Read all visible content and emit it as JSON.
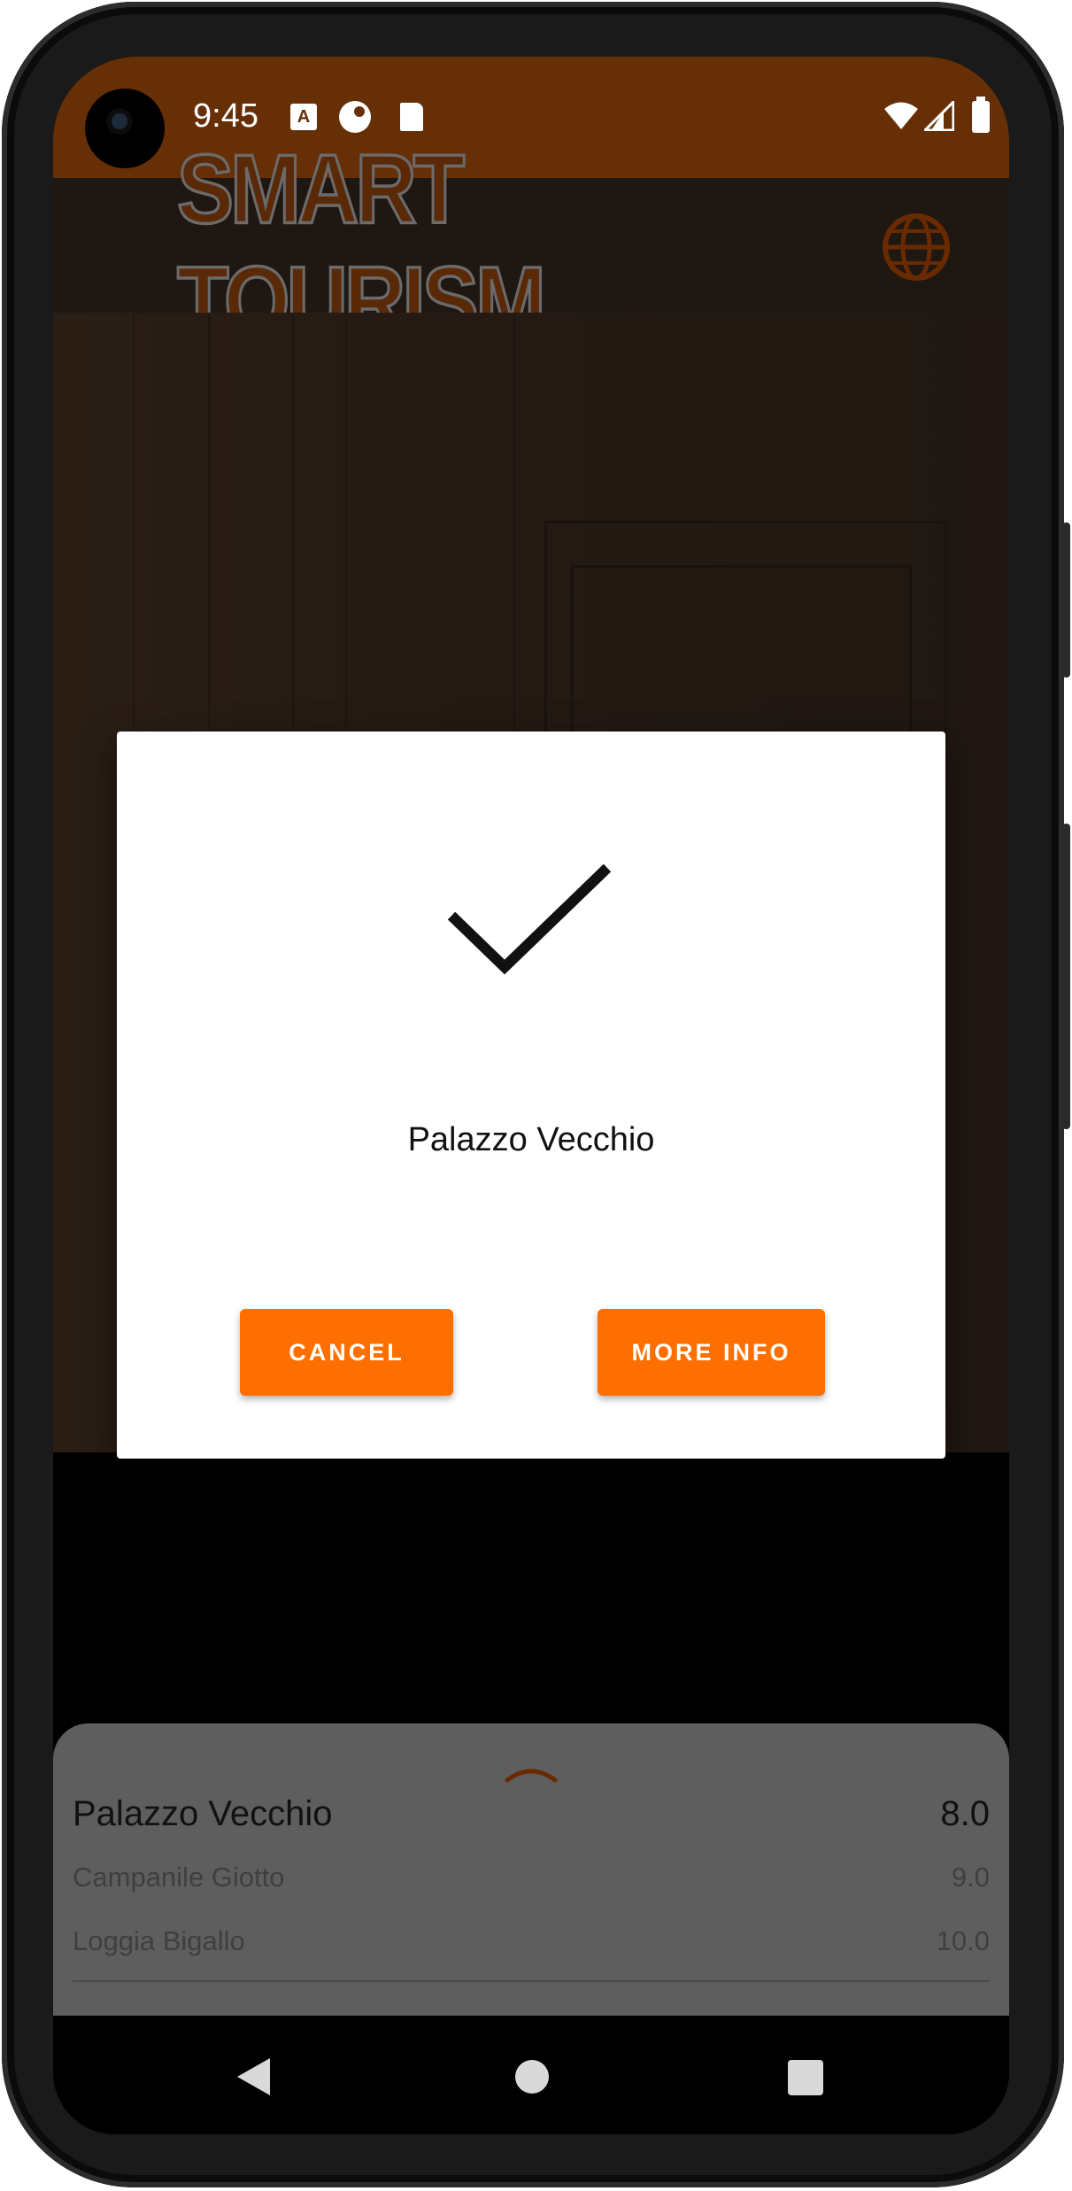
{
  "status_bar": {
    "time": "9:45",
    "icons": [
      "app-a-icon",
      "record-icon",
      "sd-card-icon",
      "wifi-icon",
      "signal-icon",
      "battery-icon"
    ]
  },
  "app_bar": {
    "logo_text": "SMART TOURISM",
    "language_icon": "globe-icon"
  },
  "dialog": {
    "icon": "check-icon",
    "title": "Palazzo Vecchio",
    "cancel_label": "CANCEL",
    "more_info_label": "MORE INFO"
  },
  "bottom_sheet": {
    "handle_icon": "chevron-up-icon",
    "items": [
      {
        "name": "Palazzo Vecchio",
        "score": "8.0"
      },
      {
        "name": "Campanile Giotto",
        "score": "9.0"
      },
      {
        "name": "Loggia Bigallo",
        "score": "10.0"
      }
    ]
  },
  "nav_bar": {
    "buttons": [
      "back-icon",
      "home-icon",
      "recents-icon"
    ]
  },
  "colors": {
    "accent": "#fe6f00",
    "status_bar": "#672f05",
    "logo": "#5a2a08"
  }
}
